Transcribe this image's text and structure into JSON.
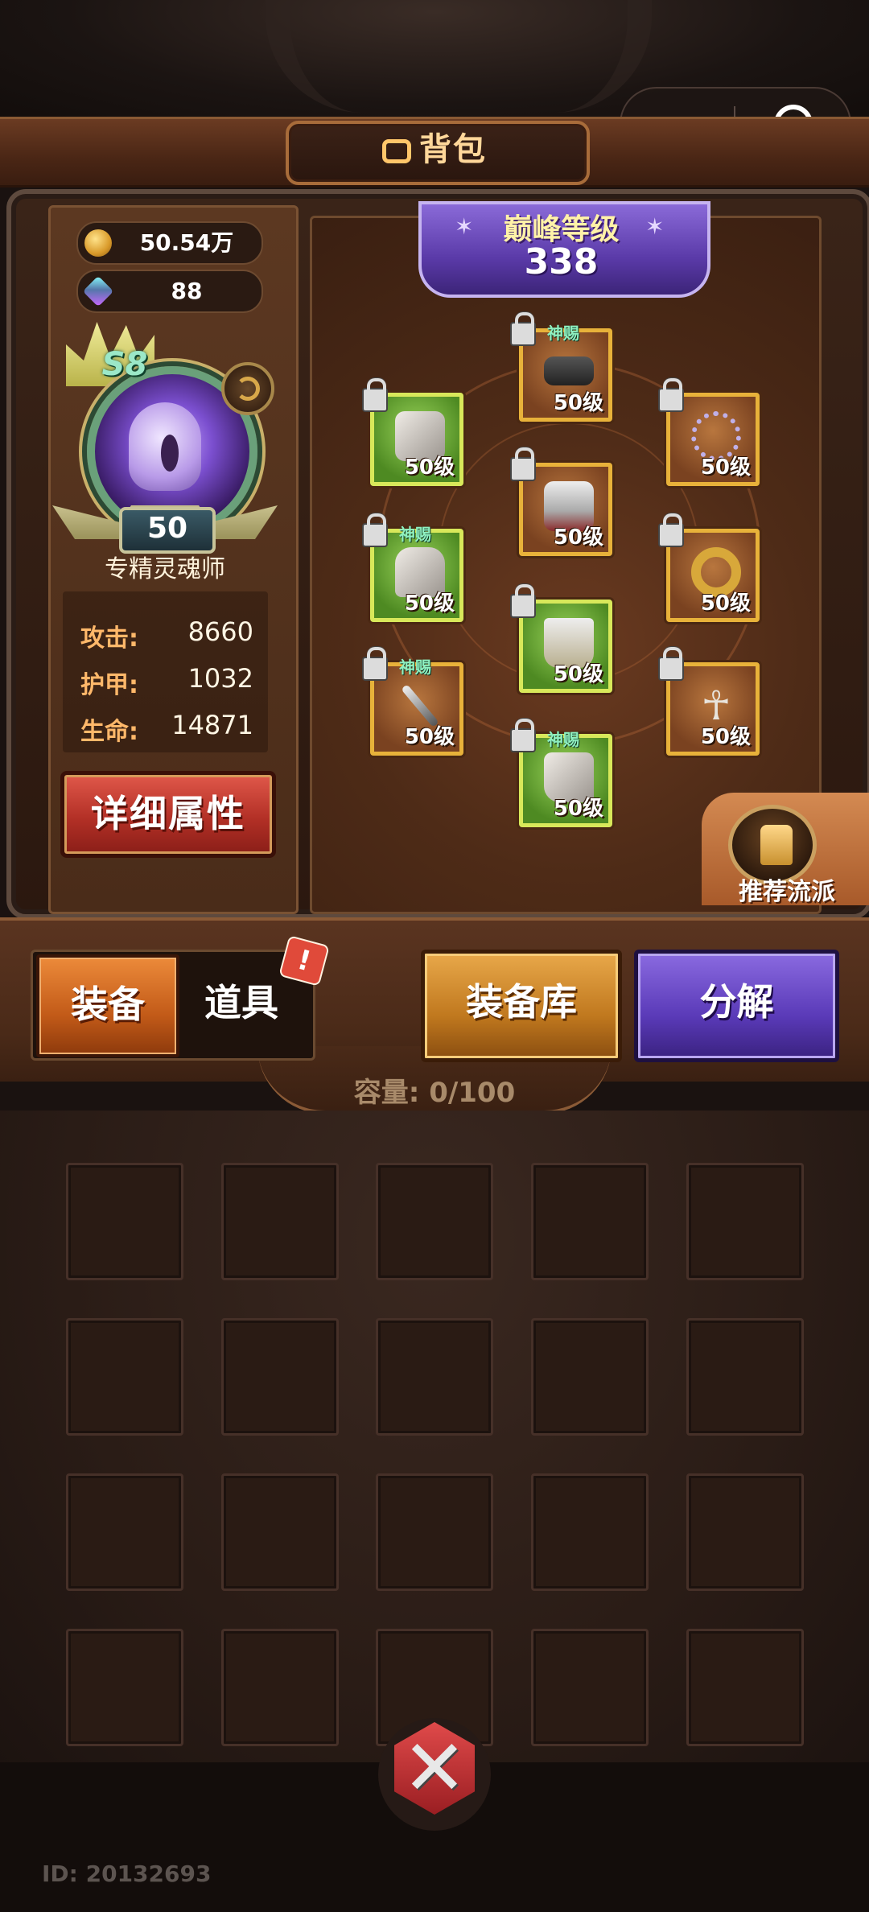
{
  "window": {
    "title": "背包"
  },
  "currency": {
    "gold": "50.54万",
    "gems": "88"
  },
  "hero": {
    "rank": "S8",
    "level": "50",
    "class_name": "专精灵魂师",
    "stats": [
      {
        "label": "攻击:",
        "value": "8660"
      },
      {
        "label": "护甲:",
        "value": "1032"
      },
      {
        "label": "生命:",
        "value": "14871"
      }
    ],
    "detail_button": "详细属性"
  },
  "peak": {
    "label": "巅峰等级",
    "value": "338"
  },
  "equipment": [
    {
      "id": "helmet",
      "level": "50级",
      "god_tag": "",
      "rarity": "green",
      "icon": "helmet-icon"
    },
    {
      "id": "cape",
      "level": "50级",
      "god_tag": "神赐",
      "rarity": "brown",
      "icon": "cape-icon"
    },
    {
      "id": "necklace",
      "level": "50级",
      "god_tag": "",
      "rarity": "brown",
      "icon": "necklace-icon"
    },
    {
      "id": "armor",
      "level": "50级",
      "god_tag": "",
      "rarity": "brown",
      "icon": "chest-armor-icon"
    },
    {
      "id": "gloves",
      "level": "50级",
      "god_tag": "神赐",
      "rarity": "green",
      "icon": "gauntlet-icon"
    },
    {
      "id": "ring",
      "level": "50级",
      "god_tag": "",
      "rarity": "brown",
      "icon": "ring-icon"
    },
    {
      "id": "pants",
      "level": "50级",
      "god_tag": "",
      "rarity": "green",
      "icon": "leg-armor-icon"
    },
    {
      "id": "weapon",
      "level": "50级",
      "god_tag": "神赐",
      "rarity": "brown",
      "icon": "staff-icon"
    },
    {
      "id": "relic",
      "level": "50级",
      "god_tag": "",
      "rarity": "brown",
      "icon": "ankh-icon"
    },
    {
      "id": "boots",
      "level": "50级",
      "god_tag": "神赐",
      "rarity": "green",
      "icon": "boots-icon"
    }
  ],
  "recommend": {
    "label": "推荐流派"
  },
  "tabs": {
    "equip": "装备",
    "items": "道具",
    "alert": "!"
  },
  "buttons": {
    "storage": "装备库",
    "decompose": "分解"
  },
  "capacity": {
    "label": "容量:",
    "value": "0/100"
  },
  "footer": {
    "id": "ID: 20132693"
  },
  "colors": {
    "accent_gold": "#e8b23a",
    "button_red": "#b33026",
    "button_purple": "#5a3ab8",
    "button_orange": "#c25a18"
  }
}
